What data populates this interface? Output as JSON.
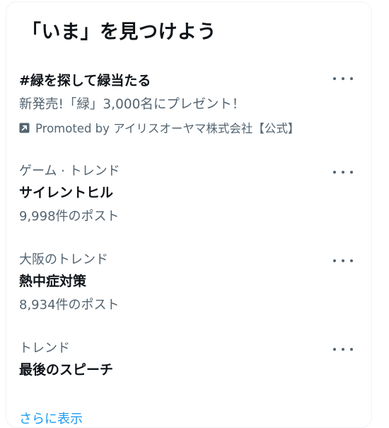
{
  "panel": {
    "title": "「いま」を見つけよう"
  },
  "promoted_item": {
    "title": "#緑を探して緑当たる",
    "description": "新発売!「緑」3,000名にプレゼント！",
    "promoted_by": "Promoted by アイリスオーヤマ株式会社【公式】",
    "icon": "promoted-arrow-icon"
  },
  "trends": [
    {
      "context": "ゲーム · トレンド",
      "title": "サイレントヒル",
      "posts": "9,998件のポスト"
    },
    {
      "context": "大阪のトレンド",
      "title": "熱中症対策",
      "posts": "8,934件のポスト"
    },
    {
      "context": "トレンド",
      "title": "最後のスピーチ"
    }
  ],
  "more_icon": "more-horizontal-icon",
  "show_more": {
    "label": "さらに表示"
  },
  "colors": {
    "text_primary": "#0f1419",
    "text_secondary": "#536471",
    "link": "#1d9bf0",
    "border": "#eff3f4"
  }
}
